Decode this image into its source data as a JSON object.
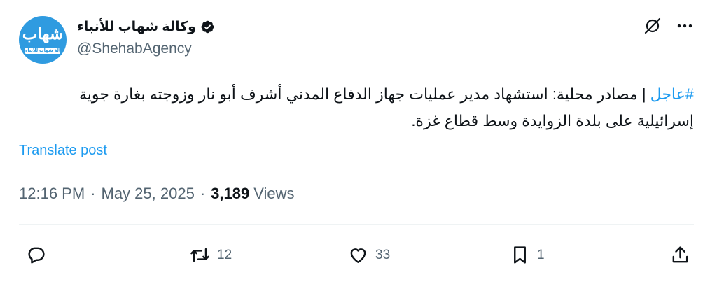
{
  "author": {
    "display_name": "وكالة شهاب للأنباء",
    "handle": "@ShehabAgency",
    "verified": true,
    "avatar": {
      "logo_text": "شهاب",
      "logo_subtext": "وكالة شهاب للأنباء",
      "background_color": "#2f9be0"
    }
  },
  "header_actions": {
    "grok_icon": "grok-icon",
    "more_icon": "more-icon"
  },
  "post": {
    "hashtag": "#عاجل",
    "text": " | مصادر محلية: استشهاد مدير عمليات جهاز الدفاع المدني أشرف أبو نار وزوجته بغارة جوية إسرائيلية على بلدة الزوايدة وسط قطاع غزة.",
    "translate_label": "Translate post"
  },
  "meta": {
    "time": "12:16 PM",
    "separator": "·",
    "date": "May 25, 2025",
    "views_count": "3,189",
    "views_label": "Views"
  },
  "actions": {
    "reply": {
      "icon": "reply-icon",
      "count": ""
    },
    "retweet": {
      "icon": "retweet-icon",
      "count": "12"
    },
    "like": {
      "icon": "heart-icon",
      "count": "33"
    },
    "bookmark": {
      "icon": "bookmark-icon",
      "count": "1"
    },
    "share": {
      "icon": "share-icon",
      "count": ""
    }
  },
  "colors": {
    "link": "#1d9bf0",
    "secondary_text": "#536471",
    "primary_text": "#0f1419",
    "divider": "#eff3f4"
  }
}
